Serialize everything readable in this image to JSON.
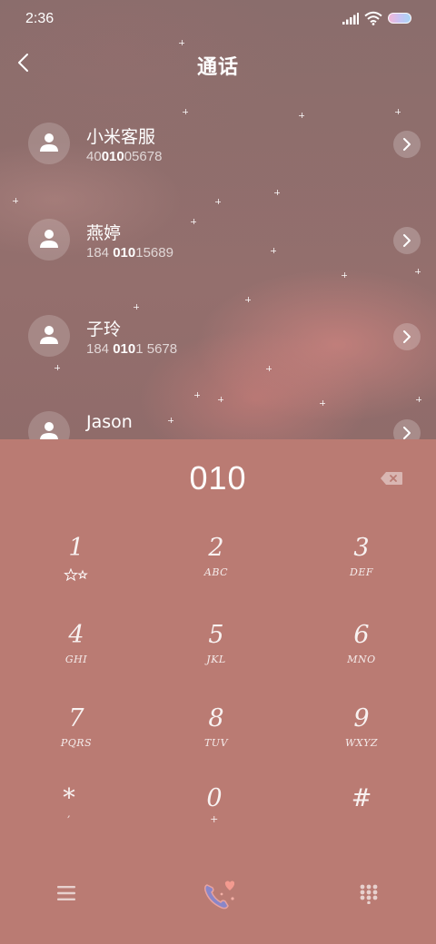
{
  "status_bar": {
    "time": "2:36"
  },
  "header": {
    "title": "通话"
  },
  "contacts": [
    {
      "name": "小米客服",
      "number_pre": "40",
      "number_match": "010",
      "number_post": "05678"
    },
    {
      "name": "燕婷",
      "number_pre": "184 ",
      "number_match": "010",
      "number_post": "15689"
    },
    {
      "name": "子玲",
      "number_pre": "184 ",
      "number_match": "010",
      "number_post": "1 5678"
    },
    {
      "name": "Jason",
      "number_pre": "",
      "number_match": "",
      "number_post": ""
    }
  ],
  "dialer": {
    "number": "010",
    "keys": [
      {
        "digit": "1",
        "letters": ""
      },
      {
        "digit": "2",
        "letters": "ABC"
      },
      {
        "digit": "3",
        "letters": "DEF"
      },
      {
        "digit": "4",
        "letters": "GHI"
      },
      {
        "digit": "5",
        "letters": "JKL"
      },
      {
        "digit": "6",
        "letters": "MNO"
      },
      {
        "digit": "7",
        "letters": "PQRS"
      },
      {
        "digit": "8",
        "letters": "TUV"
      },
      {
        "digit": "9",
        "letters": "WXYZ"
      },
      {
        "digit": "*",
        "letters": ","
      },
      {
        "digit": "0",
        "letters": "+"
      },
      {
        "digit": "#",
        "letters": ""
      }
    ]
  },
  "bottom_bar": {
    "icons": [
      "menu-icon",
      "call-icon",
      "dialpad-icon"
    ]
  },
  "colors": {
    "dialer_bg": "#ba7b73",
    "text": "#ffffff"
  }
}
